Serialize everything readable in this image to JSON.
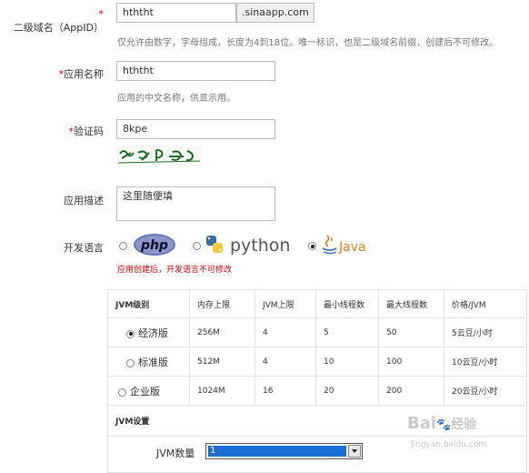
{
  "appid": {
    "label_star": "*",
    "label": "二级域名（AppID）",
    "value": "hththt",
    "suffix": ".sinaapp.com",
    "hint": "仅允许由数字，字母组成，长度为4到18位。唯一标识，也是二级域名前缀，创建后不可修改。"
  },
  "app_name": {
    "label_star": "*",
    "label": "应用名称",
    "value": "hththt",
    "hint": "应用的中文名称，供显示用。"
  },
  "captcha": {
    "label_star": "*",
    "label": "验证码",
    "value": "8kpe",
    "image_text": "8kpe"
  },
  "description": {
    "label": "应用描述",
    "value": "这里随便填"
  },
  "language": {
    "label": "开发语言",
    "options": [
      {
        "name": "php",
        "selected": false
      },
      {
        "name": "python",
        "selected": false
      },
      {
        "name": "Java",
        "selected": true
      }
    ],
    "warning": "应用创建后，开发语言不可修改"
  },
  "jvm_table": {
    "headers": [
      "JVM级别",
      "内存上限",
      "JVM上限",
      "最小线程数",
      "最大线程数",
      "价格/JVM"
    ],
    "rows": [
      {
        "level": "经济版",
        "selected": true,
        "memory": "256M",
        "jvm_limit": "4",
        "min_threads": "5",
        "max_threads": "50",
        "price": "5云豆/小时"
      },
      {
        "level": "标准版",
        "selected": false,
        "memory": "512M",
        "jvm_limit": "4",
        "min_threads": "10",
        "max_threads": "100",
        "price": "10云豆/小时"
      },
      {
        "level": "企业版",
        "selected": false,
        "memory": "1024M",
        "jvm_limit": "16",
        "min_threads": "20",
        "max_threads": "200",
        "price": "20云豆/小时"
      }
    ],
    "settings_title": "JVM设置",
    "count_label": "JVM数量",
    "count_value": "1"
  },
  "colors": {
    "required": "#dd0000",
    "php_badge": "#6a78b8",
    "python_blue": "#3670a0",
    "python_yellow": "#f4c93a",
    "java_orange": "#e07a1f",
    "select_highlight": "#1b6ed6"
  },
  "watermark": {
    "brand": "Bai",
    "brand_suffix": "经验",
    "url": "jingyan.baidu.com"
  }
}
